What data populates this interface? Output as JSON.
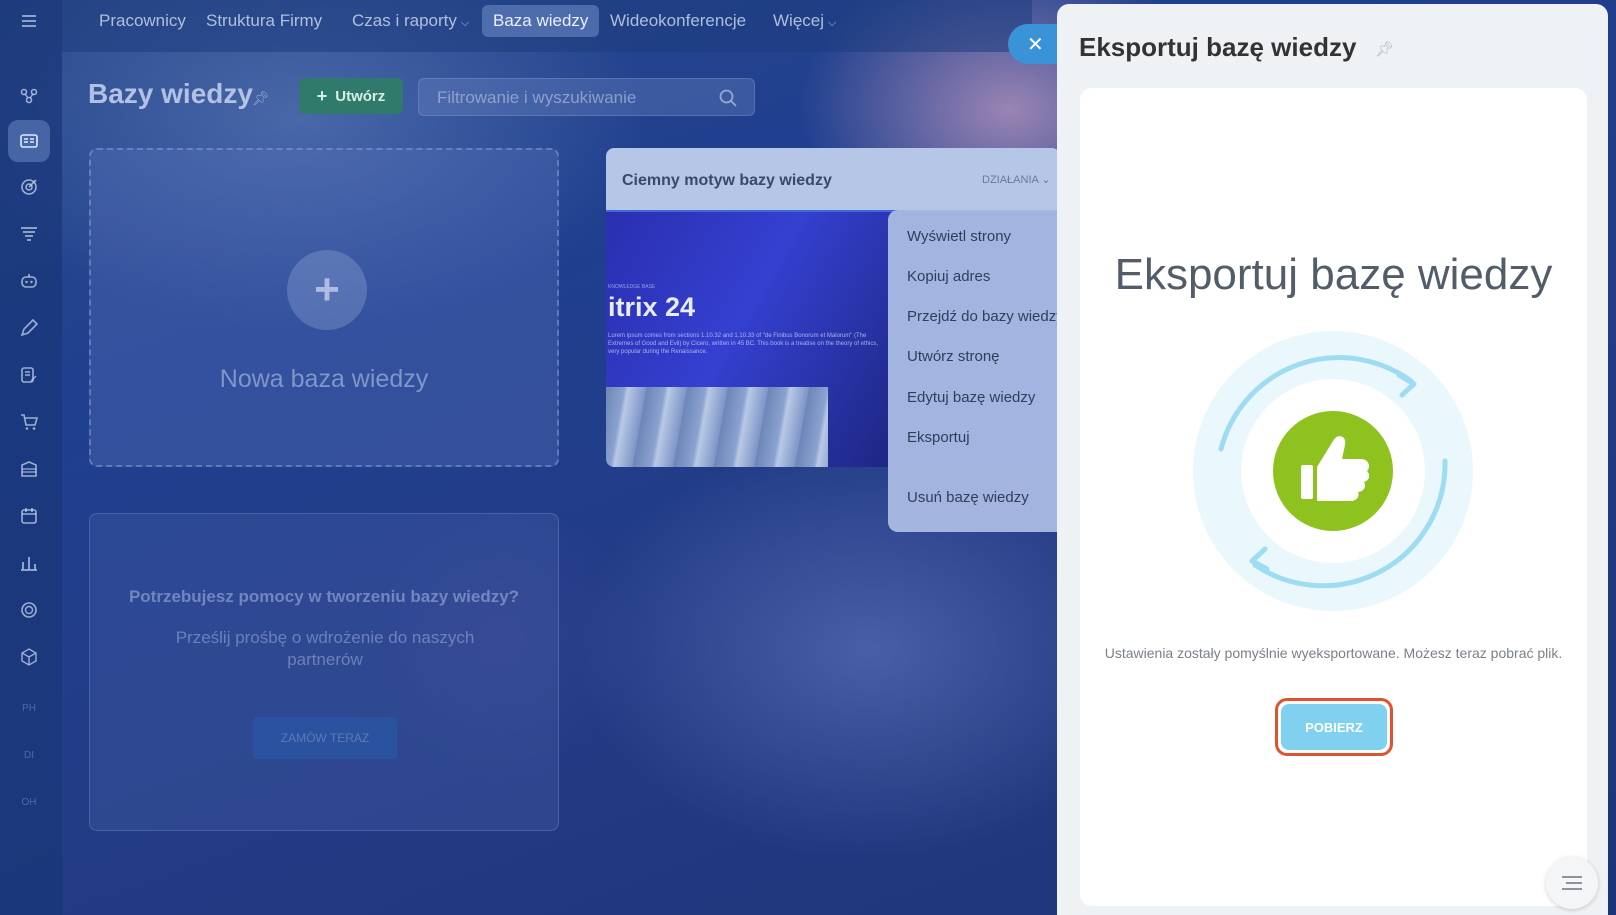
{
  "topnav": {
    "items": [
      {
        "label": "Pracownicy",
        "chevron": false
      },
      {
        "label": "Struktura Firmy",
        "chevron": false
      },
      {
        "label": "Czas i raporty",
        "chevron": true
      },
      {
        "label": "Baza wiedzy",
        "chevron": false,
        "active": true
      },
      {
        "label": "Wideokonferencje",
        "chevron": false
      },
      {
        "label": "Więcej",
        "chevron": true
      }
    ]
  },
  "sidebar": {
    "icons": [
      "menu-icon",
      "crm-icon",
      "knowledge-base-icon",
      "target-icon",
      "funnel-icon",
      "robot-icon",
      "pen-icon",
      "document-edit-icon",
      "cart-icon",
      "building-icon",
      "calendar-icon",
      "chart-icon",
      "shield-icon",
      "box-icon"
    ],
    "small_labels": [
      "PH",
      "DI",
      "OH"
    ]
  },
  "page": {
    "title": "Bazy wiedzy",
    "create_label": "Utwórz",
    "search_placeholder": "Filtrowanie i wyszukiwanie"
  },
  "new_card": {
    "label": "Nowa baza wiedzy"
  },
  "help_card": {
    "title": "Potrzebujesz pomocy w tworzeniu bazy wiedzy?",
    "subtitle": "Prześlij prośbę o wdrożenie do naszych partnerów",
    "button": "ZAMÓW TERAZ"
  },
  "theme_card": {
    "title": "Ciemny motyw bazy wiedzy",
    "actions": "DZIAŁANIA",
    "preview_tiny": "KNOWLEDGE BASE",
    "preview_big": "itrix 24",
    "preview_small": "Lorem ipsum comes from sections 1.10.32 and 1.10.33 of \"de Finibus Bonorum et Malorum\" (The Extremes of Good and Evil) by Cicero, written in 45 BC. This book is a treatise on the theory of ethics, very popular during the Renaissance."
  },
  "actions_menu": {
    "items": [
      "Wyświetl strony",
      "Kopiuj adres",
      "Przejdź do bazy wiedzy",
      "Utwórz stronę",
      "Edytuj bazę wiedzy",
      "Eksportuj",
      "Usuń bazę wiedzy"
    ]
  },
  "panel": {
    "title": "Eksportuj bazę wiedzy",
    "heading": "Eksportuj bazę wiedzy",
    "status": "Ustawienia zostały pomyślnie wyeksportowane. Możesz teraz pobrać plik.",
    "download_label": "POBIERZ",
    "accent_green": "#8dc21f",
    "accent_blue": "#7fd1ef",
    "highlight": "#e0532f"
  }
}
